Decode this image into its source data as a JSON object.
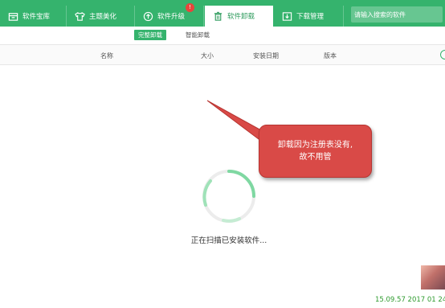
{
  "nav": {
    "tabs": [
      {
        "label": "软件宝库",
        "icon": "box-icon"
      },
      {
        "label": "主题美化",
        "icon": "shirt-icon"
      },
      {
        "label": "软件升级",
        "icon": "upload-icon",
        "badge": "!"
      },
      {
        "label": "软件卸载",
        "icon": "trash-icon"
      },
      {
        "label": "下载管理",
        "icon": "download-icon"
      }
    ],
    "search_placeholder": "请输入搜索的软件"
  },
  "subtabs": {
    "active": "完整卸载",
    "other": "智能卸载"
  },
  "columns": {
    "name": "名称",
    "size": "大小",
    "date": "安装日期",
    "version": "版本"
  },
  "status": {
    "scanning": "正在扫描已安装软件..."
  },
  "annotation": {
    "line1": "卸载因为注册表没有,",
    "line2": "故不用管"
  },
  "footer": {
    "timestamp": "15.09.57 2017 01 24"
  },
  "colors": {
    "accent": "#35b36d",
    "callout": "#d94a47",
    "timestamp": "#2e9b2e"
  }
}
